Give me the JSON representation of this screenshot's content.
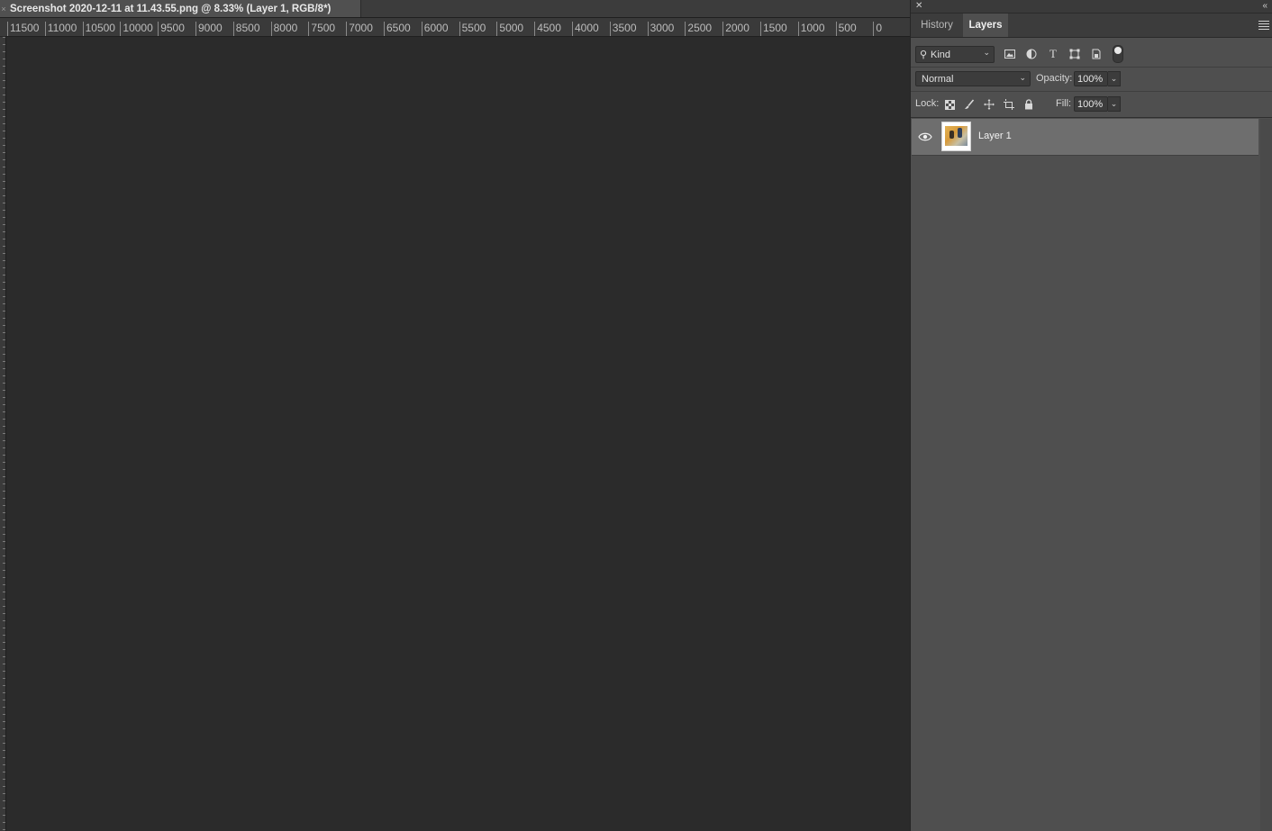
{
  "document": {
    "tab_title": "Screenshot 2020-12-11 at 11.43.55.png @ 8.33% (Layer 1, RGB/8*)"
  },
  "ruler": {
    "labels": [
      "11500",
      "11000",
      "10500",
      "10000",
      "9500",
      "9000",
      "8500",
      "8000",
      "7500",
      "7000",
      "6500",
      "6000",
      "5500",
      "5000",
      "4500",
      "4000",
      "3500",
      "3000",
      "2500",
      "2000",
      "1500",
      "1000",
      "500",
      "0"
    ]
  },
  "panel": {
    "tabs": {
      "history": "History",
      "layers": "Layers"
    },
    "filter": {
      "kind_label": "Kind"
    },
    "blend_mode": "Normal",
    "opacity_label": "Opacity:",
    "opacity_value": "100%",
    "lock_label": "Lock:",
    "fill_label": "Fill:",
    "fill_value": "100%",
    "layers": [
      {
        "name": "Layer 1",
        "visible": true,
        "selected": true
      }
    ]
  },
  "colors": {
    "canvas": "#2b2b2b",
    "panel": "#4f4f4f",
    "selected_layer": "#6e6e6e"
  }
}
